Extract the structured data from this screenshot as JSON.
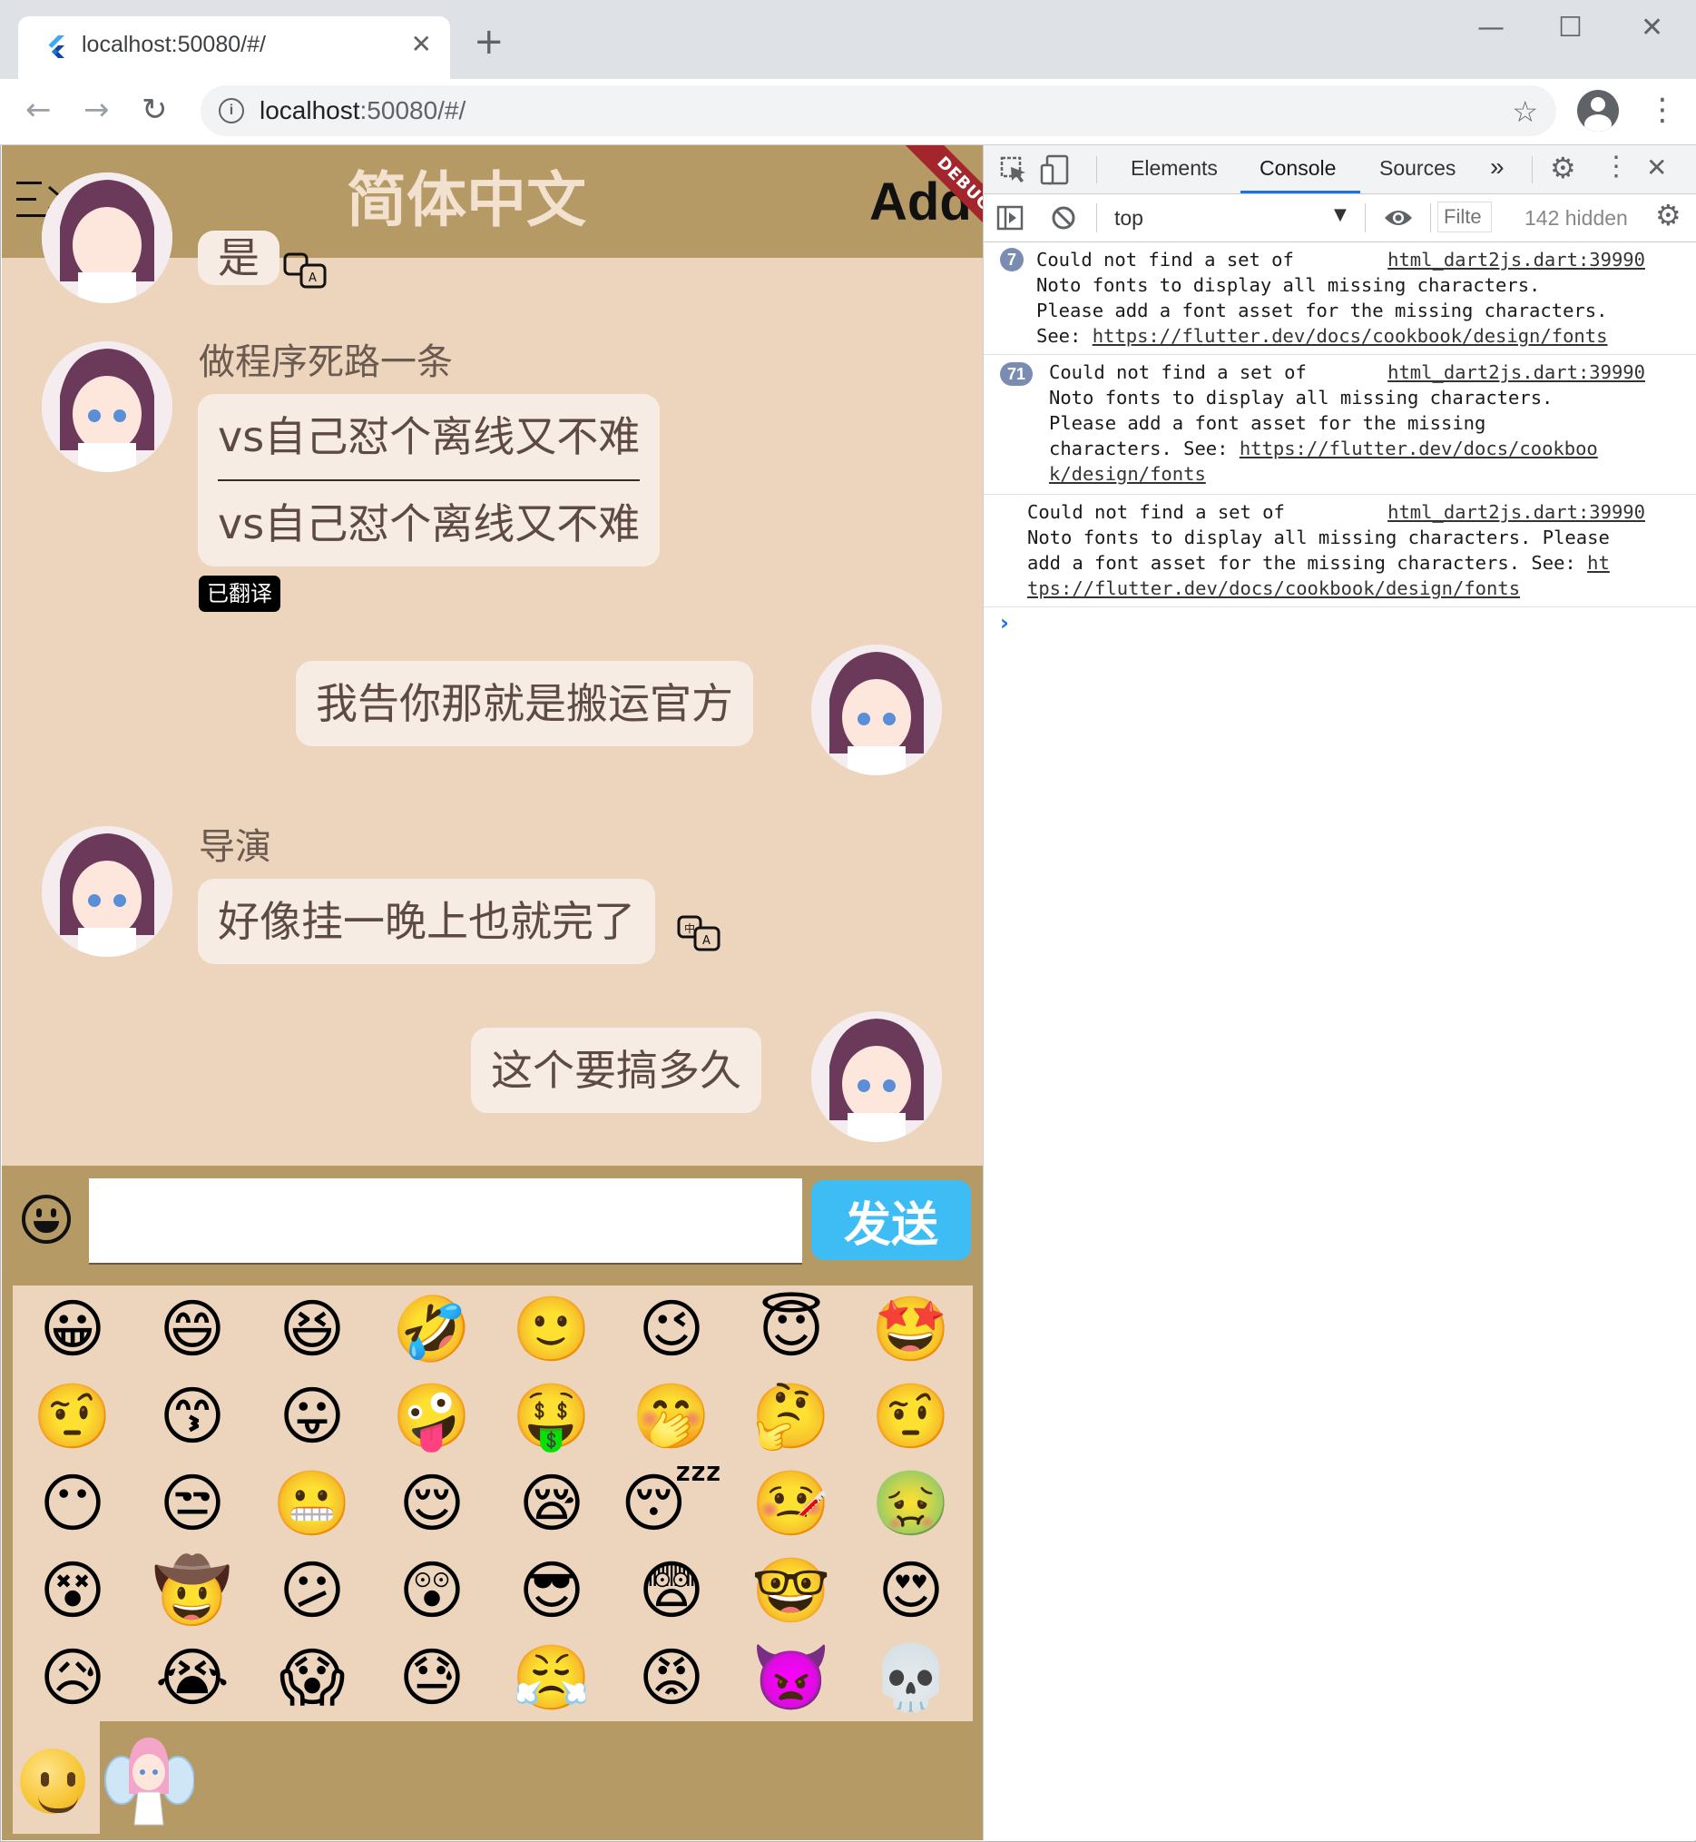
{
  "browser": {
    "tab_title": "localhost:50080/#/",
    "url_host": "localhost",
    "url_rest": ":50080/#/",
    "new_tab": "+",
    "close_tab": "✕"
  },
  "app": {
    "title": "简体中文",
    "add_label": "Add",
    "debug_banner": "DEBUG",
    "messages": [
      {
        "type": "received",
        "sender": "",
        "texts": [
          "是"
        ]
      },
      {
        "type": "received",
        "sender": "做程序死路一条",
        "texts": [
          "vs自己怼个离线又不难",
          "vs自己怼个离线又不难"
        ],
        "badge": "已翻译"
      },
      {
        "type": "sent",
        "texts": [
          "我告你那就是搬运官方"
        ]
      },
      {
        "type": "received",
        "sender": "导演",
        "texts": [
          "好像挂一晚上也就完了"
        ]
      },
      {
        "type": "sent",
        "texts": [
          "这个要搞多久"
        ]
      }
    ],
    "input": {
      "value": "",
      "placeholder": ""
    },
    "send_label": "发送",
    "emoji_rows": [
      [
        "😀",
        "😄",
        "😆",
        "🤣",
        "🙂",
        "😉",
        "😇",
        "🤩"
      ],
      [
        "🤨",
        "😙",
        "😛",
        "🤪",
        "🤑",
        "🤭",
        "🤔",
        "🤨"
      ],
      [
        "😶",
        "😒",
        "😬",
        "😌",
        "😪",
        "😴",
        "🤒",
        "🤢"
      ],
      [
        "😵",
        "🤠",
        "😕",
        "😲",
        "😎",
        "😨",
        "🤓",
        "😍"
      ],
      [
        "😥",
        "😭",
        "😱",
        "😓",
        "😤",
        "😡",
        "👿",
        "💀"
      ]
    ],
    "emoji_tab_icons": [
      "emoji-tab-icon",
      "sticker-tab-icon"
    ]
  },
  "devtools": {
    "tabs": [
      "Elements",
      "Console",
      "Sources"
    ],
    "more_tabs": "»",
    "context": "top",
    "filter_placeholder": "Filte",
    "hidden_count": "142 hidden",
    "messages": [
      {
        "count": "7",
        "lines": [
          "Could not find a set of",
          "Noto fonts to display all missing characters.",
          "Please add a font asset for the missing characters.",
          "See: "
        ],
        "link": "https://flutter.dev/docs/cookbook/design/fonts",
        "source": "html_dart2js.dart:39990"
      },
      {
        "count": "71",
        "lines": [
          "Could not find a set of",
          "Noto fonts to display all missing characters.",
          "Please add a font asset for the missing",
          "characters. See: "
        ],
        "link_part1": "https://flutter.dev/docs/cookboo",
        "link_part2": "k/design/fonts",
        "source": "html_dart2js.dart:39990"
      },
      {
        "count": "",
        "lines": [
          "Could not find a set of",
          "Noto fonts to display all missing characters. Please",
          "add a font asset for the missing characters. See: "
        ],
        "link_part1": "ht",
        "link_part2": "tps://flutter.dev/docs/cookbook/design/fonts",
        "source": "html_dart2js.dart:39990"
      }
    ],
    "prompt": "›"
  }
}
